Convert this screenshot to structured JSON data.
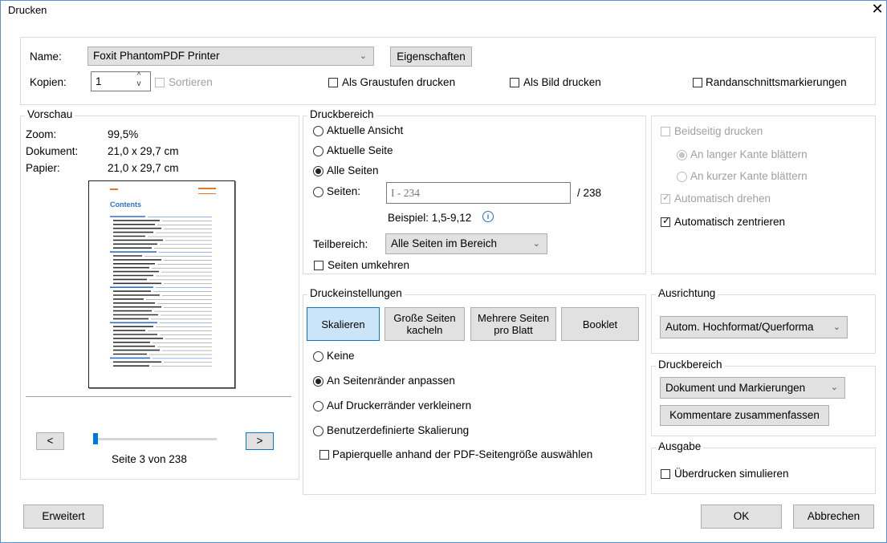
{
  "dialog": {
    "title": "Drucken",
    "close_icon": "close-icon"
  },
  "printer": {
    "name_label": "Name:",
    "name_value": "Foxit PhantomPDF Printer",
    "properties_label": "Eigenschaften",
    "copies_label": "Kopien:",
    "copies_value": "1",
    "collate_label": "Sortieren",
    "grayscale_label": "Als Graustufen drucken",
    "as_image_label": "Als Bild drucken",
    "bleed_label": "Randanschnittsmarkierungen"
  },
  "preview": {
    "legend": "Vorschau",
    "zoom_label": "Zoom:",
    "zoom_value": "99,5%",
    "document_label": "Dokument:",
    "document_value": "21,0 x 29,7 cm",
    "paper_label": "Papier:",
    "paper_value": "21,0 x 29,7 cm",
    "page_heading": "Contents",
    "prev_label": "<",
    "next_label": ">",
    "page_status": "Seite 3 von 238",
    "slider_fraction": 0.0
  },
  "print_range": {
    "legend": "Druckbereich",
    "current_view": "Aktuelle Ansicht",
    "current_page": "Aktuelle Seite",
    "all_pages": "Alle Seiten",
    "pages_label": "Seiten:",
    "pages_value": "I - 234",
    "pages_total": "/ 238",
    "example": "Beispiel: 1,5-9,12",
    "subset_label": "Teilbereich:",
    "subset_value": "Alle Seiten im Bereich",
    "reverse_label": "Seiten umkehren"
  },
  "print_settings": {
    "legend": "Druckeinstellungen",
    "tabs": [
      {
        "label": "Skalieren"
      },
      {
        "label": "Große Seiten kacheln"
      },
      {
        "label": "Mehrere Seiten pro Blatt"
      },
      {
        "label": "Booklet"
      }
    ],
    "none": "Keine",
    "fit": "An Seitenränder anpassen",
    "shrink": "Auf Druckerränder verkleinern",
    "custom": "Benutzerdefinierte Skalierung",
    "paper_source": "Papierquelle anhand der PDF-Seitengröße auswählen"
  },
  "duplex": {
    "duplex_label": "Beidseitig drucken",
    "long_edge": "An langer Kante blättern",
    "short_edge": "An kurzer Kante blättern",
    "auto_rotate": "Automatisch drehen",
    "auto_center": "Automatisch zentrieren"
  },
  "orientation": {
    "legend": "Ausrichtung",
    "value": "Autom. Hochformat/Querforma"
  },
  "print_what": {
    "legend": "Druckbereich",
    "value": "Dokument und Markierungen",
    "summarize_label": "Kommentare zusammenfassen"
  },
  "output": {
    "legend": "Ausgabe",
    "overprint_label": "Überdrucken simulieren"
  },
  "footer": {
    "advanced_label": "Erweitert",
    "ok_label": "OK",
    "cancel_label": "Abbrechen"
  },
  "colors": {
    "accent": "#0078d7",
    "link": "#2f6fd0",
    "orange": "#e07a2a"
  }
}
